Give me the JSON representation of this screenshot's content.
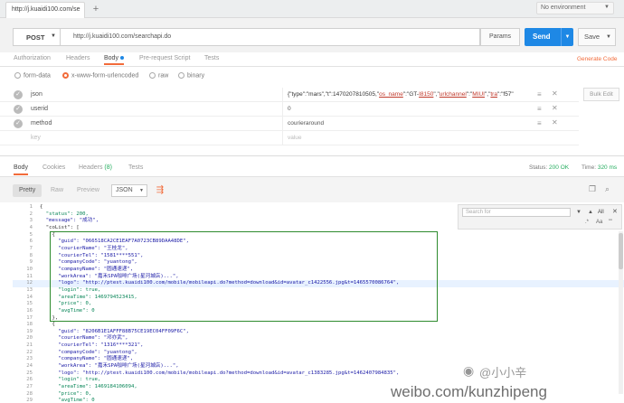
{
  "tabs": {
    "active_title": "http://j.kuaidi100.com/se",
    "add_label": "+"
  },
  "environment": {
    "label": "No environment"
  },
  "request": {
    "method": "POST",
    "url": "http://j.kuaidi100.com/searchapi.do",
    "params_label": "Params",
    "send_label": "Send",
    "save_label": "Save"
  },
  "request_tabs": [
    "Authorization",
    "Headers",
    "Body",
    "Pre-request Script",
    "Tests"
  ],
  "generate_code": "Generate Code",
  "body_types": [
    "form-data",
    "x-www-form-urlencoded",
    "raw",
    "binary"
  ],
  "params": [
    {
      "key": "json",
      "value_pre": "{\"type\":\"mars\",\"t\":1470207810505,\"",
      "value_hl1": "os_name",
      "value_mid": "\":\"GT-",
      "value_hl2": "I8150",
      "value_mid2": "\",\"",
      "value_hl3": "urlchannel",
      "value_mid3": "\":\"",
      "value_hl4": "MIUI",
      "value_mid4": "\",\"",
      "value_hl5": "tra",
      "value_end": "\":\"f57\""
    },
    {
      "key": "userid",
      "value": "0"
    },
    {
      "key": "method",
      "value": "courieraround"
    },
    {
      "key": "key",
      "value": "value"
    }
  ],
  "bulk_edit": "Bulk Edit",
  "response_tabs": {
    "body": "Body",
    "cookies": "Cookies",
    "headers": "Headers",
    "headers_count": "(8)",
    "tests": "Tests"
  },
  "status": {
    "label": "Status:",
    "value": "200 OK"
  },
  "time": {
    "label": "Time:",
    "value": "320 ms"
  },
  "view_modes": [
    "Pretty",
    "Raw",
    "Preview"
  ],
  "format": "JSON",
  "find": {
    "placeholder": "Search for",
    "all": "All",
    "opt_regex": ".*",
    "opt_case": "Aa",
    "opt_word": "\"\""
  },
  "code_lines": [
    {
      "n": "1",
      "t": "{"
    },
    {
      "n": "2",
      "t": "  \"status\": 200,"
    },
    {
      "n": "3",
      "t": "  \"message\": \"成功\","
    },
    {
      "n": "4",
      "t": "  \"coList\": ["
    },
    {
      "n": "5",
      "t": "    {"
    },
    {
      "n": "6",
      "t": "      \"guid\": \"066518CA2CE1EAF7A0723CB89DAA48DE\","
    },
    {
      "n": "7",
      "t": "      \"courierName\": \"王桂龙\","
    },
    {
      "n": "8",
      "t": "      \"courierTel\": \"1581****551\","
    },
    {
      "n": "9",
      "t": "      \"companyCode\": \"yuantong\","
    },
    {
      "n": "10",
      "t": "      \"companyName\": \"圆通速递\","
    },
    {
      "n": "11",
      "t": "      \"workArea\": \"嘉禾SPA咖啡广场(星河城店)...\","
    },
    {
      "n": "12",
      "t": "      \"logo\": \"http://ptest.kuaidi100.com/mobile/mobileapi.do?method=download&id=avatar_c1422556.jpg&t=1465570086764\","
    },
    {
      "n": "13",
      "t": "      \"login\": true,"
    },
    {
      "n": "14",
      "t": "      \"areaTime\": 1469794523415,"
    },
    {
      "n": "15",
      "t": "      \"price\": 0,"
    },
    {
      "n": "16",
      "t": "      \"avgTime\": 0"
    },
    {
      "n": "17",
      "t": "    },"
    },
    {
      "n": "18",
      "t": "    {"
    },
    {
      "n": "19",
      "t": "      \"guid\": \"8206B1E1AFFF88B75CE19EC04FF09F6C\","
    },
    {
      "n": "20",
      "t": "      \"courierName\": \"邓亦武\","
    },
    {
      "n": "21",
      "t": "      \"courierTel\": \"1316****321\","
    },
    {
      "n": "22",
      "t": "      \"companyCode\": \"yuantong\","
    },
    {
      "n": "23",
      "t": "      \"companyName\": \"圆通速递\","
    },
    {
      "n": "24",
      "t": "      \"workArea\": \"嘉禾SPA咖啡广场(星河城店)...\","
    },
    {
      "n": "25",
      "t": "      \"logo\": \"http://ptest.kuaidi100.com/mobile/mobileapi.do?method=download&id=avatar_c1383285.jpg&t=1462407984835\","
    },
    {
      "n": "26",
      "t": "      \"login\": true,"
    },
    {
      "n": "27",
      "t": "      \"areaTime\": 1469184106094,"
    },
    {
      "n": "28",
      "t": "      \"price\": 0,"
    },
    {
      "n": "29",
      "t": "      \"avgTime\": 0"
    }
  ],
  "watermark": {
    "text": "weibo.com/kunzhipeng",
    "handle": "@小小辛",
    "logo": "新浪"
  }
}
